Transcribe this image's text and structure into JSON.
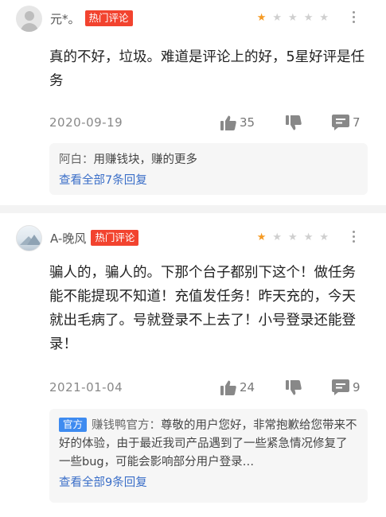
{
  "reviews": [
    {
      "user": "元*。",
      "badge": "热门评论",
      "rating": 1,
      "content": "真的不好，垃圾。难道是评论上的好，5星好评是任务",
      "date": "2020-09-19",
      "likes": "35",
      "comments": "7",
      "reply": {
        "official_tag": "",
        "author": "阿白：",
        "text": "用赚钱块，赚的更多"
      },
      "view_all": "查看全部7条回复"
    },
    {
      "user": "A-晚风",
      "badge": "热门评论",
      "rating": 1,
      "content": "骗人的，骗人的。下那个台子都别下这个！做任务能不能提现不知道！充值发任务！昨天充的，今天就出毛病了。号就登录不上去了！小号登录还能登录！",
      "date": "2021-01-04",
      "likes": "24",
      "comments": "9",
      "reply": {
        "official_tag": "官方",
        "author": "赚钱鸭官方：",
        "text": "尊敬的用户您好，非常抱歉给您带来不好的体验，由于最近我司产品遇到了一些紧急情况修复了一些bug，可能会影响部分用户登录…"
      },
      "view_all": "查看全部9条回复"
    }
  ],
  "icons": {
    "star": "star-icon",
    "like": "thumbs-up-icon",
    "dislike": "thumbs-down-icon",
    "comment": "comment-icon",
    "more": "more-vertical-icon"
  },
  "colors": {
    "badge": "#f2432f",
    "star_on": "#f59a23",
    "star_off": "#cfcfcf",
    "link": "#3a6ec8",
    "official": "#3e8bf0"
  }
}
